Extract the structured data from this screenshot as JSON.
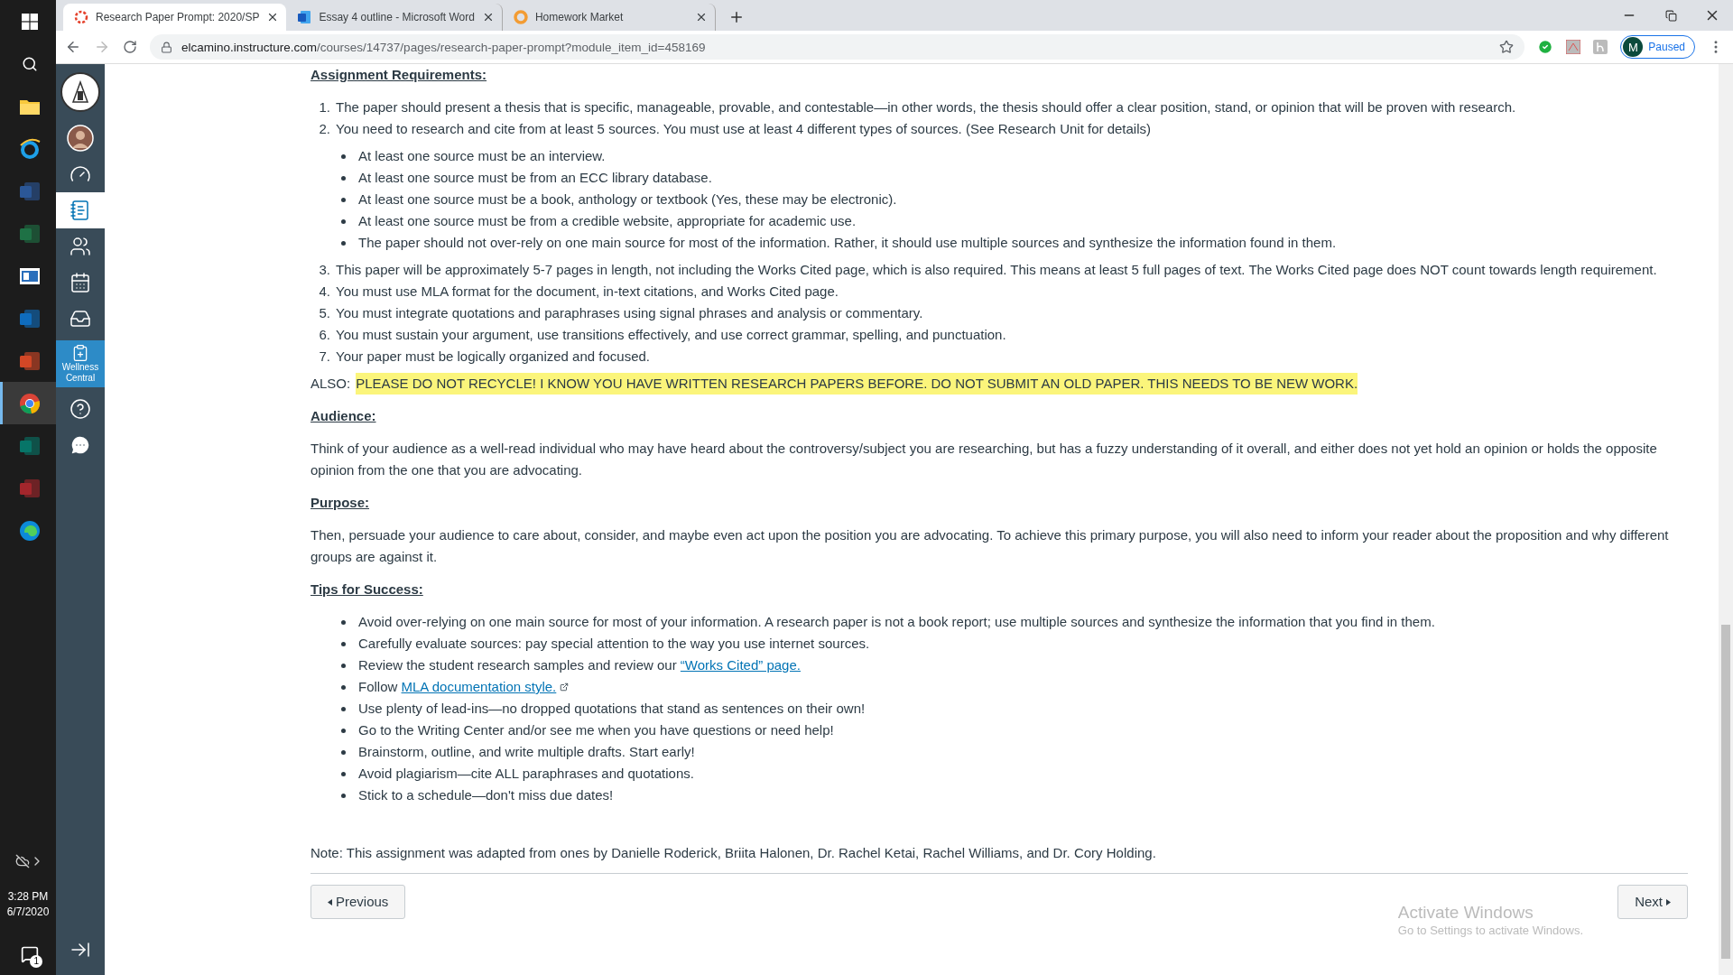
{
  "taskbar": {
    "apps": [
      {
        "kind": "folder",
        "active": false
      },
      {
        "kind": "globe-e",
        "active": false
      },
      {
        "kind": "tile-blue",
        "active": false
      },
      {
        "kind": "tile-green",
        "active": false
      },
      {
        "kind": "reader",
        "active": false
      },
      {
        "kind": "tile-mail",
        "active": false
      },
      {
        "kind": "tile-orange",
        "active": false
      },
      {
        "kind": "chrome",
        "active": true
      },
      {
        "kind": "tile-teal",
        "active": false
      },
      {
        "kind": "tile-red",
        "active": false
      },
      {
        "kind": "edge",
        "active": false
      }
    ],
    "time": "3:28 PM",
    "date": "6/7/2020",
    "notifications": "1"
  },
  "browser": {
    "tabs": [
      {
        "title": "Research Paper Prompt: 2020/SP",
        "selected": true
      },
      {
        "title": "Essay 4 outline - Microsoft Word",
        "selected": false
      },
      {
        "title": "Homework Market",
        "selected": false
      }
    ],
    "url": {
      "domain": "elcamino.instructure.com",
      "path": "/courses/14737/pages/research-paper-prompt?module_item_id=458169"
    },
    "profile": {
      "initial": "M",
      "status": "Paused"
    }
  },
  "nav": {
    "items": [
      {
        "kind": "logo",
        "selected": false
      },
      {
        "kind": "avatar",
        "selected": false
      },
      {
        "kind": "dashboard",
        "selected": false
      },
      {
        "kind": "courses",
        "selected": true
      },
      {
        "kind": "groups",
        "selected": false
      },
      {
        "kind": "calendar",
        "selected": false
      },
      {
        "kind": "inbox",
        "selected": false
      },
      {
        "kind": "wellness",
        "label": "Wellness Central",
        "selected": false
      },
      {
        "kind": "help",
        "selected": false
      },
      {
        "kind": "chat",
        "selected": false
      }
    ]
  },
  "content": [
    {
      "kind": "heading",
      "text": "Assignment Requirements:"
    },
    {
      "kind": "ol",
      "items": [
        {
          "number": "1.",
          "text": "The paper should present a thesis that is specific, manageable, provable, and contestable—in other words, the thesis should offer a clear position, stand, or opinion that will be proven with research."
        },
        {
          "number": "2.",
          "text": "You need to research and cite from at least 5 sources. You must use at least 4 different types of sources. (See Research Unit for details)"
        }
      ]
    },
    {
      "kind": "ul",
      "items": [
        {
          "text": "At least one source must be an interview."
        },
        {
          "text": "At least one source must be from an ECC library database."
        },
        {
          "text": "At least one source must be a book, anthology or textbook (Yes, these may be electronic)."
        },
        {
          "text": "At least one source must be from a credible website, appropriate for academic use."
        },
        {
          "text": "The paper should not over-rely on one main source for most of the information. Rather, it should use multiple sources and synthesize the information found in them."
        }
      ]
    },
    {
      "kind": "ol",
      "items": [
        {
          "number": "3.",
          "text": "This paper will be approximately 5-7 pages in length, not including the Works Cited page, which is also required. This means at least 5 full pages of text.  The Works Cited page does NOT count towards length requirement."
        },
        {
          "number": "4.",
          "text": "You must use MLA format for the document, in-text citations, and Works Cited page."
        },
        {
          "number": "5.",
          "text": "You must integrate quotations and paraphrases using signal phrases and analysis or commentary."
        },
        {
          "number": "6.",
          "text": "You must sustain your argument, use transitions effectively, and use correct grammar, spelling, and punctuation."
        },
        {
          "number": "7.",
          "text": "Your paper must be logically organized and focused."
        }
      ]
    },
    {
      "kind": "also",
      "label": "ALSO:",
      "text": "PLEASE DO NOT RECYCLE!  I KNOW YOU HAVE WRITTEN RESEARCH PAPERS BEFORE.  DO NOT SUBMIT AN OLD PAPER.  THIS NEEDS TO BE NEW WORK."
    },
    {
      "kind": "heading",
      "text": "Audience:"
    },
    {
      "kind": "paragraph",
      "text": "Think of your audience as a well-read individual who may have heard about the controversy/subject you are researching, but has a fuzzy understanding of it overall, and either does not yet hold an opinion or holds the opposite opinion from the one that you are advocating."
    },
    {
      "kind": "heading",
      "text": "Purpose:"
    },
    {
      "kind": "paragraph",
      "text": "Then, persuade your audience to care about, consider, and maybe even act upon the position you are advocating. To achieve this primary purpose, you will also need to inform your reader about the proposition and why different groups are against it."
    },
    {
      "kind": "heading",
      "text": "Tips for Success:"
    },
    {
      "kind": "ul",
      "items": [
        {
          "text": "Avoid over-relying on one main source for most of your information. A research paper is not a book report; use multiple sources and synthesize the information that you find in them."
        },
        {
          "text": "Carefully evaluate sources: pay special attention to the way you use internet sources."
        },
        {
          "text": "Review the student research samples and review our",
          "link": "“Works Cited” page.",
          "external": false
        },
        {
          "text": "Follow",
          "link": "MLA documentation style.",
          "external": true
        },
        {
          "text": "Use plenty of lead-ins—no dropped quotations that stand as sentences on their own!"
        },
        {
          "text": "Go to the Writing Center and/or see me when you have questions or need help!"
        },
        {
          "text": "Brainstorm, outline, and write multiple drafts. Start early!"
        },
        {
          "text": "Avoid plagiarism—cite ALL paraphrases and quotations."
        },
        {
          "text": "Stick to a schedule—don't miss due dates!"
        }
      ]
    },
    {
      "kind": "note",
      "text": "Note: This assignment was adapted from ones by Danielle Roderick, Briita Halonen, Dr. Rachel Ketai, Rachel Williams, and Dr. Cory Holding."
    }
  ],
  "pager": {
    "previous": "Previous",
    "next": "Next"
  },
  "activation": {
    "title": "Activate Windows",
    "subtitle": "Go to Settings to activate Windows."
  }
}
